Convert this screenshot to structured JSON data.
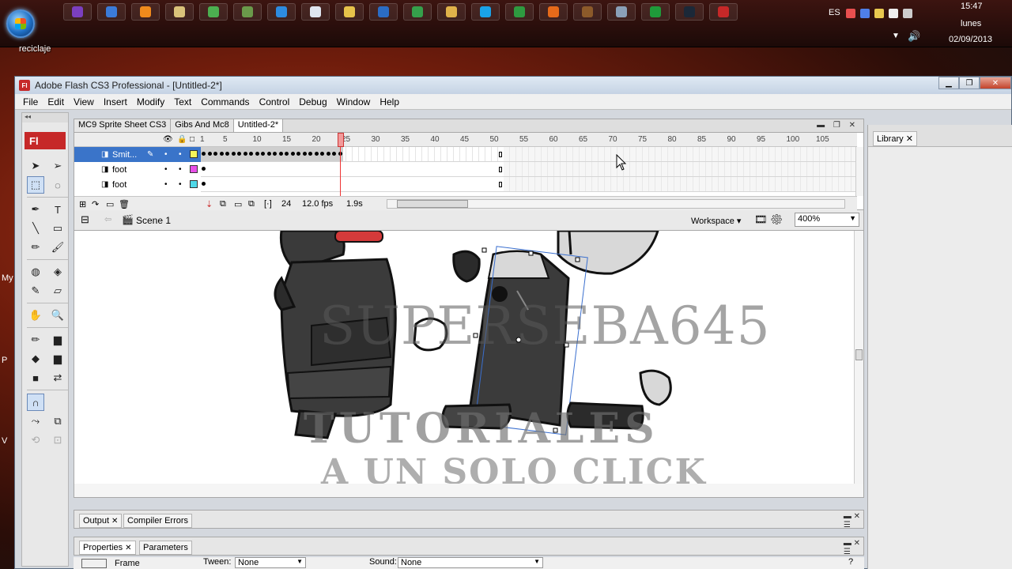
{
  "desktop": {
    "icon_label": "reciclaje",
    "side_labels": [
      "My",
      "P",
      "V"
    ]
  },
  "taskbar": {
    "apps": [
      {
        "icon": "purple-app-icon",
        "color": "#7b3fbf"
      },
      {
        "icon": "browser-icon",
        "color": "#3b7bd9"
      },
      {
        "icon": "media-player-icon",
        "color": "#f08a1c"
      },
      {
        "icon": "folder-icon",
        "color": "#d9c27a"
      },
      {
        "icon": "chrome-icon",
        "color": "#4caf50"
      },
      {
        "icon": "tool-icon",
        "color": "#6a9a4a"
      },
      {
        "icon": "globe-icon",
        "color": "#2d8be0"
      },
      {
        "icon": "document-icon",
        "color": "#dfe6f0"
      },
      {
        "icon": "paint-icon",
        "color": "#e6c24a"
      },
      {
        "icon": "network-icon",
        "color": "#2b6cc4"
      },
      {
        "icon": "game-icon",
        "color": "#35a04b"
      },
      {
        "icon": "explorer-icon",
        "color": "#e0b24a"
      },
      {
        "icon": "skype-icon",
        "color": "#1aa3e8"
      },
      {
        "icon": "game2-icon",
        "color": "#2e9a40"
      },
      {
        "icon": "firefox-icon",
        "color": "#e66a1a"
      },
      {
        "icon": "warcraft-icon",
        "color": "#8c5a2a"
      },
      {
        "icon": "car-icon",
        "color": "#8aa0b8"
      },
      {
        "icon": "utorrent-icon",
        "color": "#1f9a3a"
      },
      {
        "icon": "steam-icon",
        "color": "#1b2838"
      },
      {
        "icon": "flash-icon",
        "color": "#c62828"
      }
    ],
    "flash_label": "Fl",
    "tray": {
      "lang": "ES",
      "time": "15:47",
      "day": "lunes",
      "date": "02/09/2013"
    }
  },
  "window": {
    "title": "Adobe Flash CS3 Professional - [Untitled-2*]",
    "badge": "Fl",
    "menu": [
      "File",
      "Edit",
      "View",
      "Insert",
      "Modify",
      "Text",
      "Commands",
      "Control",
      "Debug",
      "Window",
      "Help"
    ]
  },
  "tools": {
    "logo": "Fl",
    "collapse": "◂◂"
  },
  "document": {
    "tabs": [
      "MC9 Sprite Sheet CS3",
      "Gibs And Mc8",
      "Untitled-2*"
    ],
    "active_tab": 2
  },
  "timeline": {
    "ruler": [
      "1",
      "5",
      "10",
      "15",
      "20",
      "25",
      "30",
      "35",
      "40",
      "45",
      "50",
      "55",
      "60",
      "65",
      "70",
      "75",
      "80",
      "85",
      "90",
      "95",
      "100",
      "105"
    ],
    "current_frame": 24,
    "layers": [
      {
        "name": "Smit...",
        "color": "#f5f55a",
        "selected": true,
        "keyframes": 24
      },
      {
        "name": "foot",
        "color": "#e84fe8",
        "selected": false,
        "keyframes": 1
      },
      {
        "name": "foot",
        "color": "#4fd8e8",
        "selected": false,
        "keyframes": 1
      }
    ],
    "footer": {
      "frame": "24",
      "fps": "12.0 fps",
      "time": "1.9s"
    }
  },
  "editbar": {
    "scene": "Scene 1",
    "workspace": "Workspace",
    "zoom": "400%"
  },
  "stage": {
    "watermark_1": "SUPERSEBA645",
    "watermark_2": "TUTORIALES",
    "watermark_3": "A UN SOLO CLICK"
  },
  "panels": {
    "output_tabs": [
      "Output",
      "Compiler Errors"
    ],
    "property_tabs": [
      "Properties",
      "Parameters"
    ],
    "frame_label": "Frame",
    "tween_label": "Tween:",
    "tween_value": "None",
    "sound_label": "Sound:",
    "sound_value": "None"
  },
  "library": {
    "tab": "Library"
  }
}
